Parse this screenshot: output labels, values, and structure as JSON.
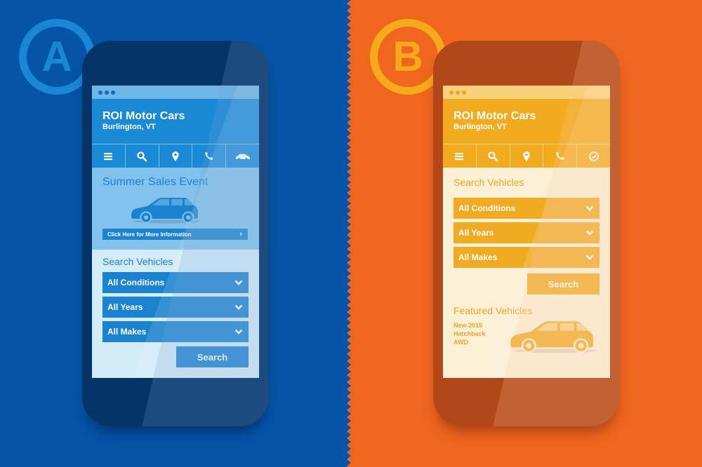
{
  "variants": {
    "a": {
      "badge_letter": "A",
      "theme": {
        "background": "#0554a8",
        "accent": "#1a82cf",
        "phone": "#053468"
      },
      "app": {
        "title": "ROI Motor Cars",
        "subtitle": "Burlington, VT"
      },
      "nav_icons": [
        "menu-icon",
        "search-icon",
        "location-pin-icon",
        "phone-icon",
        "car-icon"
      ],
      "promo": {
        "title": "Summer Sales Event",
        "link_label": "Click Here for More Information",
        "link_arrow": "›"
      },
      "search": {
        "title": "Search Vehicles",
        "selects": [
          {
            "selected": "All Conditions"
          },
          {
            "selected": "All Years"
          },
          {
            "selected": "All Makes"
          }
        ],
        "button_label": "Search"
      }
    },
    "b": {
      "badge_letter": "B",
      "theme": {
        "background": "#f0661f",
        "accent": "#f0ab22",
        "phone": "#b2481a"
      },
      "app": {
        "title": "ROI Motor Cars",
        "subtitle": "Burlington, VT"
      },
      "nav_icons": [
        "menu-icon",
        "search-icon",
        "location-pin-icon",
        "phone-icon",
        "checkmark-circle-icon"
      ],
      "search": {
        "title": "Search Vehicles",
        "selects": [
          {
            "selected": "All Conditions"
          },
          {
            "selected": "All Years"
          },
          {
            "selected": "All Makes"
          }
        ],
        "button_label": "Search"
      },
      "featured": {
        "title": "Featured Vehicles",
        "vehicle_lines": [
          "New 2015",
          "Hatchback",
          "AWD"
        ]
      }
    }
  }
}
